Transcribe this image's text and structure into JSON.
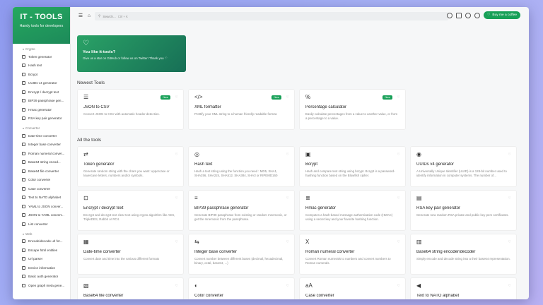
{
  "brand": {
    "title": "IT - TOOLS",
    "subtitle": "Handy tools for developers"
  },
  "sidebar": {
    "sections": [
      {
        "title": "Crypto",
        "items": [
          "Token generator",
          "Hash text",
          "Bcrypt",
          "UUIDs v4 generator",
          "Encrypt / decrypt text",
          "BIP39 passphrase gen...",
          "Hmac generator",
          "RSA key pair generator"
        ]
      },
      {
        "title": "Converter",
        "items": [
          "Date-time converter",
          "Integer base converter",
          "Roman numeral conver...",
          "Base64 string encod...",
          "Base64 file converter",
          "Color converter",
          "Case converter",
          "Text to NATO alphabet",
          "YAML to JSON conver...",
          "JSON to YAML convert...",
          "List converter"
        ]
      },
      {
        "title": "Web",
        "items": [
          "Encode/decode url for...",
          "Escape html entities",
          "Url parser",
          "Device information",
          "Basic auth generator",
          "Open graph meta gene..."
        ]
      }
    ]
  },
  "topbar": {
    "search_placeholder": "Search...",
    "search_shortcut": "Ctrl + K",
    "coffee_label": "Buy me a coffee"
  },
  "hero": {
    "title": "You like it-tools?",
    "text": "Give us a star on GitHub or follow us on Twitter! Thank you ♡"
  },
  "newest": {
    "title": "Newest Tools",
    "badge": "New",
    "cards": [
      {
        "icon": "list-icon",
        "glyph": "☰",
        "title": "JSON to CSV",
        "desc": "Convert JSON to CSV with automatic header detection."
      },
      {
        "icon": "code-icon",
        "glyph": "</>",
        "title": "XML formatter",
        "desc": "Prettify your XML string to a human friendly readable format."
      },
      {
        "icon": "percent-icon",
        "glyph": "%",
        "title": "Percentage calculator",
        "desc": "Easily calculate percentages from a value to another value, or from a percentage to a value."
      }
    ]
  },
  "all": {
    "title": "All the tools",
    "cards": [
      {
        "icon": "shuffle-icon",
        "glyph": "⇄",
        "title": "Token generator",
        "desc": "Generate random string with the chars you want: uppercase or lowercase letters, numbers and/or symbols."
      },
      {
        "icon": "eye-off-icon",
        "glyph": "◎",
        "title": "Hash text",
        "desc": "Hash a text string using the function you need : MD5, SHA1, SHA256, SHA224, SHA512, SHA384, SHA3 or RIPEMD160"
      },
      {
        "icon": "lock-square-icon",
        "glyph": "▣",
        "title": "Bcrypt",
        "desc": "Hash and compare text string using bcrypt. Bcrypt is a password-hashing function based on the Blowfish cipher."
      },
      {
        "icon": "fingerprint-icon",
        "glyph": "◉",
        "title": "UUIDs v4 generator",
        "desc": "A Universally Unique Identifier (UUID) is a 128-bit number used to identify information in computer systems. The number of..."
      },
      {
        "icon": "lock-icon",
        "glyph": "⊡",
        "title": "Encrypt / decrypt text",
        "desc": "Encrypt and decrypt text clear text using crypto algorithm like AES, TripleDES, Rabbit or RC4."
      },
      {
        "icon": "alignment-icon",
        "glyph": "≡",
        "title": "BIP39 passphrase generator",
        "desc": "Generate BIP39 passphrase from existing or random mnemonic, or get the mnemonic from the passphrase."
      },
      {
        "icon": "short-text-icon",
        "glyph": "≣",
        "title": "Hmac generator",
        "desc": "Computes a hash-based message authentication code (HMAC) using a secret key and your favorite hashing function."
      },
      {
        "icon": "certificate-icon",
        "glyph": "▤",
        "title": "RSA key pair generator",
        "desc": "Generate new random RSA private and public key pem certificates."
      },
      {
        "icon": "calendar-icon",
        "glyph": "▦",
        "title": "Date-time converter",
        "desc": "Convert date and time into the various different formats"
      },
      {
        "icon": "arrows-icon",
        "glyph": "⇆",
        "title": "Integer base converter",
        "desc": "Convert number between different bases (decimal, hexadecimal, binary, octal, base64, ...)"
      },
      {
        "icon": "letter-x-icon",
        "glyph": "X",
        "title": "Roman numeral converter",
        "desc": "Convert Roman numerals to numbers and convert numbers to Roman numerals."
      },
      {
        "icon": "file-digit-icon",
        "glyph": "▥",
        "title": "Base64 string encoder/decoder",
        "desc": "Simply encode and decode string into a their base64 representation."
      },
      {
        "icon": "file-icon",
        "glyph": "▧",
        "title": "Base64 file converter",
        "desc": ""
      },
      {
        "icon": "palette-icon",
        "glyph": "◐",
        "title": "Color converter",
        "desc": ""
      },
      {
        "icon": "letter-case-icon",
        "glyph": "aA",
        "title": "Case converter",
        "desc": ""
      },
      {
        "icon": "speakerphone-icon",
        "glyph": "◀",
        "title": "Text to NATO alphabet",
        "desc": ""
      }
    ]
  }
}
